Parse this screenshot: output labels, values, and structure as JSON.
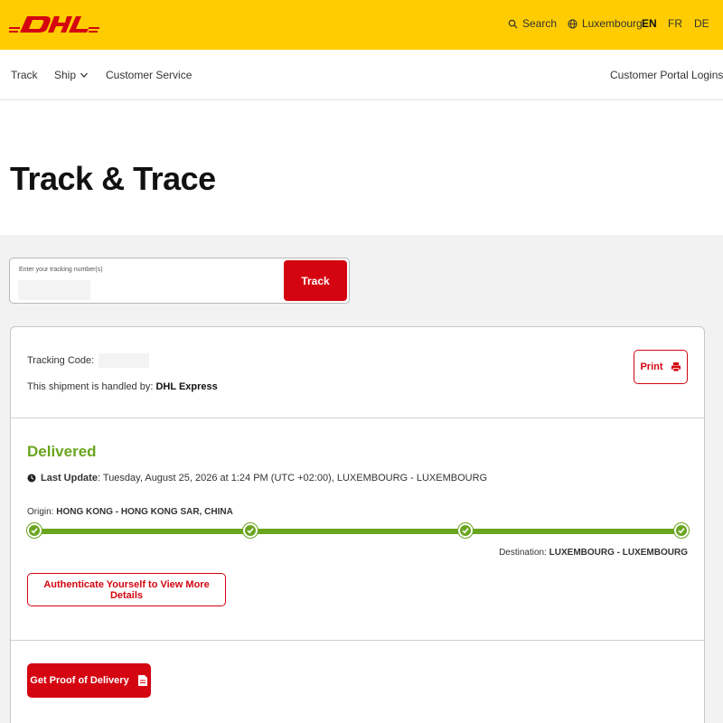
{
  "header": {
    "logo_text": "DHL",
    "search_label": "Search",
    "region_label": "Luxembourg",
    "languages": [
      {
        "code": "EN",
        "active": true
      },
      {
        "code": "FR",
        "active": false
      },
      {
        "code": "DE",
        "active": false
      }
    ]
  },
  "nav": {
    "track": "Track",
    "ship": "Ship",
    "customer_service": "Customer Service",
    "portal_logins": "Customer Portal Logins"
  },
  "page": {
    "title": "Track & Trace"
  },
  "track_form": {
    "label": "Enter your tracking number(s)",
    "input_value": "",
    "button": "Track"
  },
  "shipment": {
    "tracking_code_label": "Tracking Code:",
    "tracking_code_value": "",
    "handled_by_label": "This shipment is handled by:",
    "handled_by_value": "DHL Express",
    "print_label": "Print",
    "status": "Delivered",
    "last_update_label": "Last Update",
    "last_update_value": ": Tuesday, August 25, 2026 at 1:24 PM (UTC +02:00), LUXEMBOURG - LUXEMBOURG",
    "origin_label": "Origin:",
    "origin_value": "HONG KONG - HONG KONG SAR, CHINA",
    "destination_label": "Destination:",
    "destination_value": "LUXEMBOURG - LUXEMBOURG",
    "progress_steps_completed": 4,
    "progress_steps_total": 4,
    "auth_button": "Authenticate Yourself to View More Details",
    "pod_button": "Get Proof of Delivery"
  },
  "colors": {
    "brand_yellow": "#fecc00",
    "brand_red": "#d40511",
    "delivered_green": "#6aa51e"
  },
  "icons": {
    "search": "search-icon",
    "globe": "globe-icon",
    "chevron": "chevron-down-icon",
    "print": "printer-icon",
    "clock": "clock-icon",
    "check": "check-icon",
    "document": "document-icon"
  }
}
